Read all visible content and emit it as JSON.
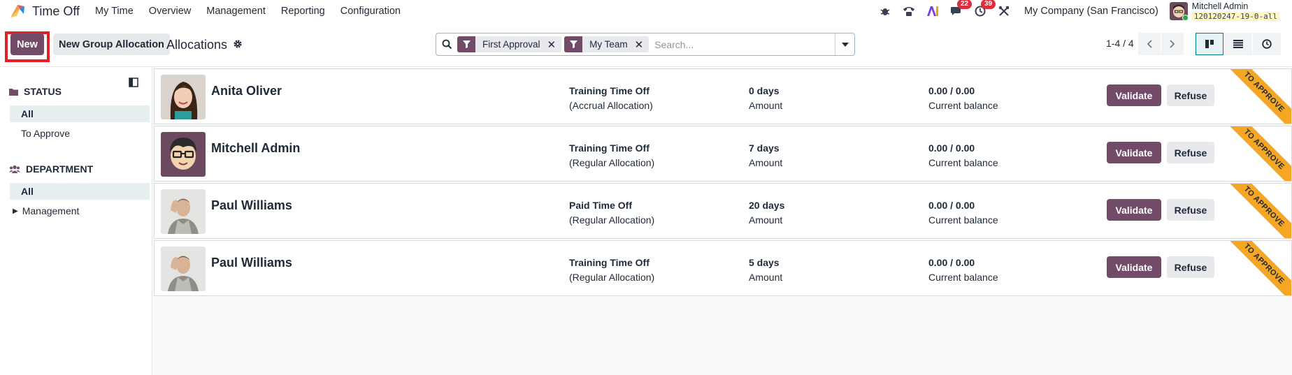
{
  "app": {
    "name": "Time Off"
  },
  "menu": [
    "My Time",
    "Overview",
    "Management",
    "Reporting",
    "Configuration"
  ],
  "systray": {
    "messages_count": "22",
    "activities_count": "39",
    "company": "My Company (San Francisco)",
    "user_name": "Mitchell Admin",
    "database": "120120247-19-0-all"
  },
  "control_panel": {
    "new_label": "New",
    "group_allocation_label": "New Group Allocation",
    "title": "Allocations",
    "facets": [
      "First Approval",
      "My Team"
    ],
    "search_placeholder": "Search...",
    "pager": "1-4 / 4"
  },
  "sidepanel": {
    "status": {
      "title": "STATUS",
      "items": [
        {
          "label": "All",
          "active": true
        },
        {
          "label": "To Approve",
          "active": false
        }
      ]
    },
    "department": {
      "title": "DEPARTMENT",
      "items": [
        {
          "label": "All",
          "active": true
        },
        {
          "label": "Management",
          "active": false
        }
      ]
    }
  },
  "records": [
    {
      "employee": "Anita Oliver",
      "leave_type": "Training Time Off",
      "allocation_type": "(Accrual Allocation)",
      "days": "0 days",
      "amount_label": "Amount",
      "balance": "0.00 / 0.00",
      "balance_label": "Current balance",
      "validate": "Validate",
      "refuse": "Refuse",
      "ribbon": "TO APPROVE"
    },
    {
      "employee": "Mitchell Admin",
      "leave_type": "Training Time Off",
      "allocation_type": "(Regular Allocation)",
      "days": "7 days",
      "amount_label": "Amount",
      "balance": "0.00 / 0.00",
      "balance_label": "Current balance",
      "validate": "Validate",
      "refuse": "Refuse",
      "ribbon": "TO APPROVE"
    },
    {
      "employee": "Paul Williams",
      "leave_type": "Paid Time Off",
      "allocation_type": "(Regular Allocation)",
      "days": "20 days",
      "amount_label": "Amount",
      "balance": "0.00 / 0.00",
      "balance_label": "Current balance",
      "validate": "Validate",
      "refuse": "Refuse",
      "ribbon": "TO APPROVE"
    },
    {
      "employee": "Paul Williams",
      "leave_type": "Training Time Off",
      "allocation_type": "(Regular Allocation)",
      "days": "5 days",
      "amount_label": "Amount",
      "balance": "0.00 / 0.00",
      "balance_label": "Current balance",
      "validate": "Validate",
      "refuse": "Refuse",
      "ribbon": "TO APPROVE"
    }
  ],
  "colors": {
    "primary": "#714b67",
    "ribbon": "#f5a623",
    "highlight": "#e31e24"
  }
}
